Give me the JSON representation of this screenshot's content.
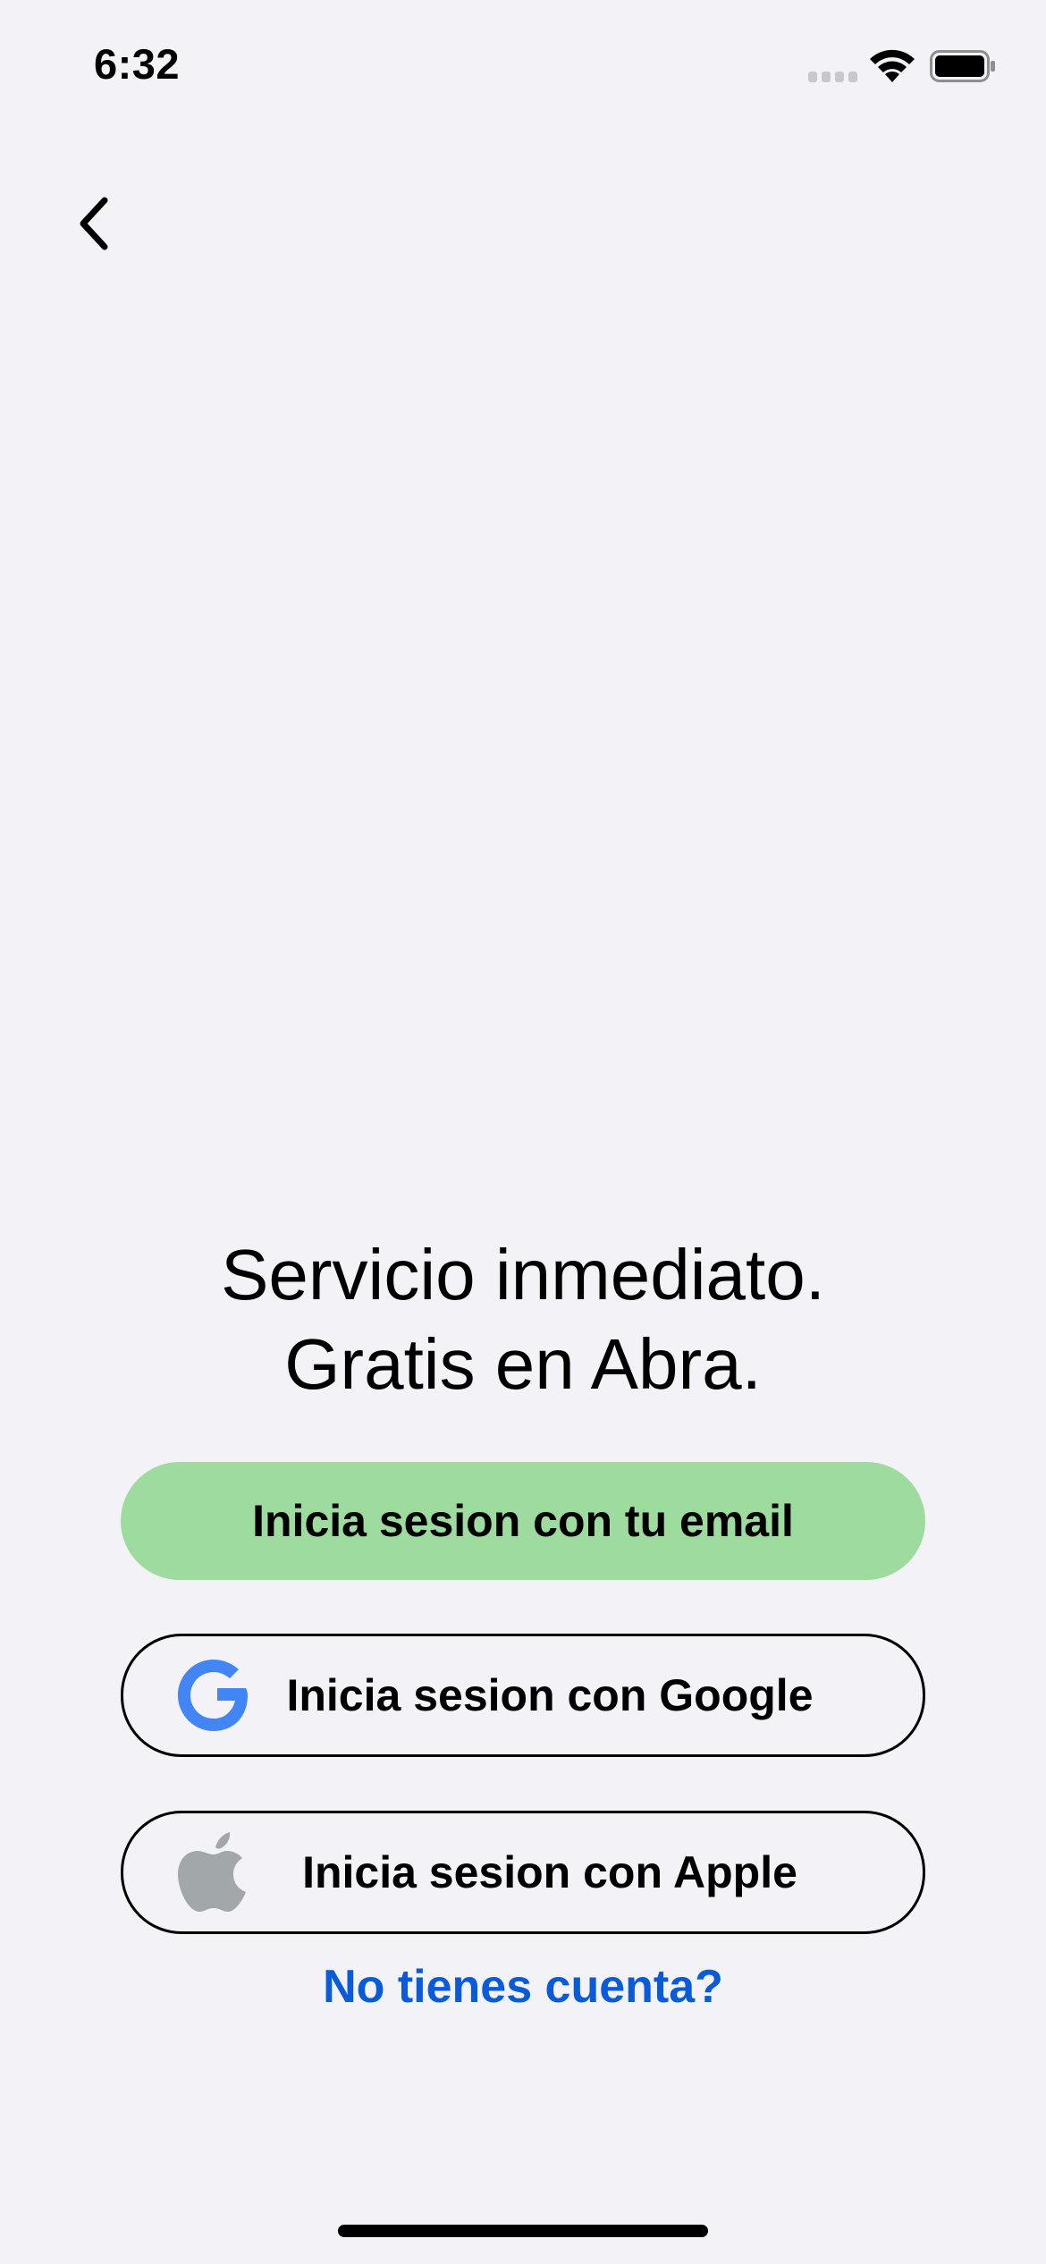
{
  "status_bar": {
    "time": "6:32",
    "icons": [
      "cellular-signal-icon",
      "wifi-icon",
      "battery-icon"
    ]
  },
  "nav": {
    "back_icon": "chevron-left-icon"
  },
  "headline": {
    "line1": "Servicio inmediato.",
    "line2": "Gratis en Abra."
  },
  "buttons": {
    "email_label": "Inicia sesion con tu email",
    "google_label": "Inicia sesion con Google",
    "apple_label": "Inicia sesion con Apple"
  },
  "signup_link": "No tienes cuenta?",
  "colors": {
    "background": "#f2f2f7",
    "primary_button": "#9edb9e",
    "link": "#0a5bd9",
    "google_blue": "#4285f4",
    "apple_gray": "#a2a7aa"
  }
}
